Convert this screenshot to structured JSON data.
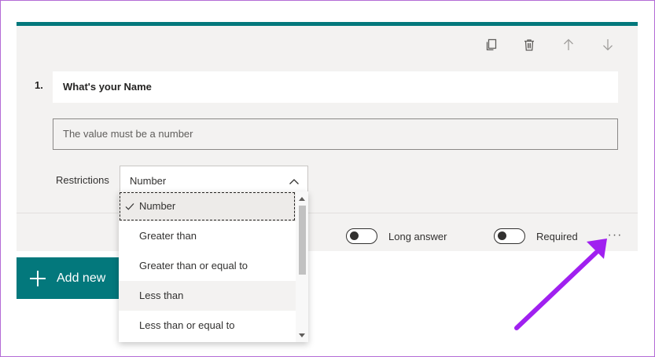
{
  "question": {
    "number": "1.",
    "title": "What's your Name",
    "answer_placeholder": "The value must be a number"
  },
  "toolbar": {
    "icons": [
      "copy-icon",
      "trash-icon",
      "arrow-up-icon",
      "arrow-down-icon"
    ]
  },
  "restrictions": {
    "label": "Restrictions",
    "selected": "Number",
    "options": [
      {
        "label": "Number",
        "selected": true
      },
      {
        "label": "Greater than",
        "selected": false
      },
      {
        "label": "Greater than or equal to",
        "selected": false
      },
      {
        "label": "Less than",
        "selected": false
      },
      {
        "label": "Less than or equal to",
        "selected": false
      }
    ]
  },
  "toggles": {
    "long_answer": {
      "label": "Long answer",
      "on": false
    },
    "required": {
      "label": "Required",
      "on": false
    }
  },
  "more_label": "···",
  "add_new_label": "Add new",
  "colors": {
    "accent": "#03787c",
    "card_bg": "#f3f2f1",
    "annotation_arrow": "#a020f0"
  }
}
